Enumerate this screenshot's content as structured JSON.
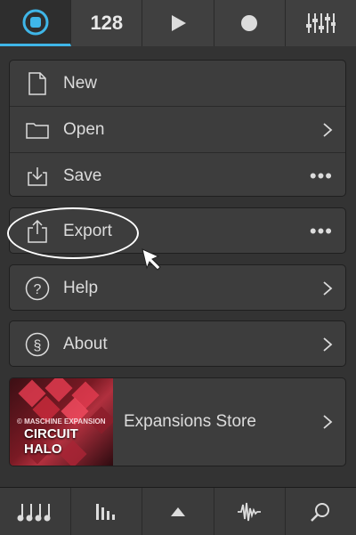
{
  "toolbar": {
    "tempo": "128",
    "icons": [
      "maschine-logo-icon",
      "play-icon",
      "record-icon",
      "mixer-icon"
    ]
  },
  "menu": {
    "file": [
      {
        "label": "New",
        "icon": "document-icon"
      },
      {
        "label": "Open",
        "icon": "folder-icon",
        "right": "chevron"
      },
      {
        "label": "Save",
        "icon": "save-tray-icon",
        "right": "more"
      }
    ],
    "export": {
      "label": "Export",
      "icon": "share-icon",
      "right": "more"
    },
    "help": {
      "label": "Help",
      "icon": "question-circle-icon",
      "right": "chevron"
    },
    "about": {
      "label": "About",
      "icon": "section-sign-icon",
      "right": "chevron"
    },
    "store": {
      "label": "Expansions Store",
      "image_brand": "© MASCHINE EXPANSION",
      "image_title": "CIRCUIT HALO"
    },
    "more_glyph": "•••"
  },
  "bottombar": {
    "icons": [
      "notes-icon",
      "steps-icon",
      "triangle-up-icon",
      "waveform-icon",
      "search-icon"
    ]
  },
  "colors": {
    "accent": "#3fb6e8",
    "background": "#2a2a2a",
    "panel": "#3d3d3d"
  }
}
